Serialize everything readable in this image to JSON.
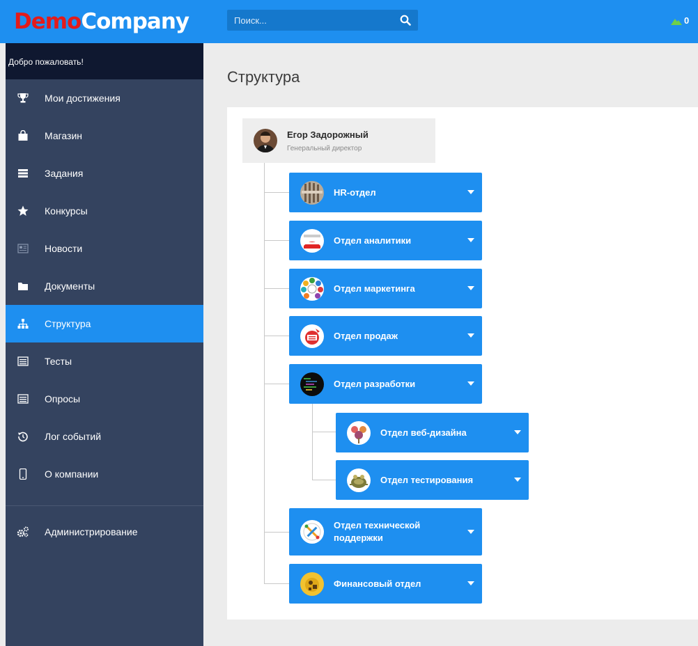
{
  "header": {
    "logo_part1": "Demo",
    "logo_part2": "Company",
    "search_placeholder": "Поиск...",
    "points": "0"
  },
  "sidebar": {
    "welcome": "Добро пожаловать!",
    "items": [
      {
        "label": "Мои достижения",
        "icon": "trophy-icon"
      },
      {
        "label": "Магазин",
        "icon": "shopping-bag-icon"
      },
      {
        "label": "Задания",
        "icon": "tasks-icon"
      },
      {
        "label": "Конкурсы",
        "icon": "star-icon"
      },
      {
        "label": "Новости",
        "icon": "newspaper-icon"
      },
      {
        "label": "Документы",
        "icon": "folder-icon"
      },
      {
        "label": "Структура",
        "icon": "sitemap-icon"
      },
      {
        "label": "Тесты",
        "icon": "list-icon"
      },
      {
        "label": "Опросы",
        "icon": "list-icon"
      },
      {
        "label": "Лог событий",
        "icon": "history-icon"
      },
      {
        "label": "О компании",
        "icon": "phone-icon"
      }
    ],
    "admin": {
      "label": "Администрирование",
      "icon": "gears-icon"
    }
  },
  "page": {
    "title": "Структура"
  },
  "ceo": {
    "name": "Егор Задорожный",
    "role": "Генеральный директор"
  },
  "departments": [
    {
      "label": "HR-отдел"
    },
    {
      "label": "Отдел аналитики"
    },
    {
      "label": "Отдел маркетинга"
    },
    {
      "label": "Отдел продаж"
    },
    {
      "label": "Отдел разработки"
    },
    {
      "label": "Отдел веб-дизайна"
    },
    {
      "label": "Отдел тестирования"
    },
    {
      "label": "Отдел технической поддержки"
    },
    {
      "label": "Финансовый отдел"
    }
  ],
  "colors": {
    "accent": "#1e8ff0",
    "sidebar_bg": "#34435f",
    "welcome_bg": "#0f1830",
    "logo_red": "#e31b1b"
  }
}
